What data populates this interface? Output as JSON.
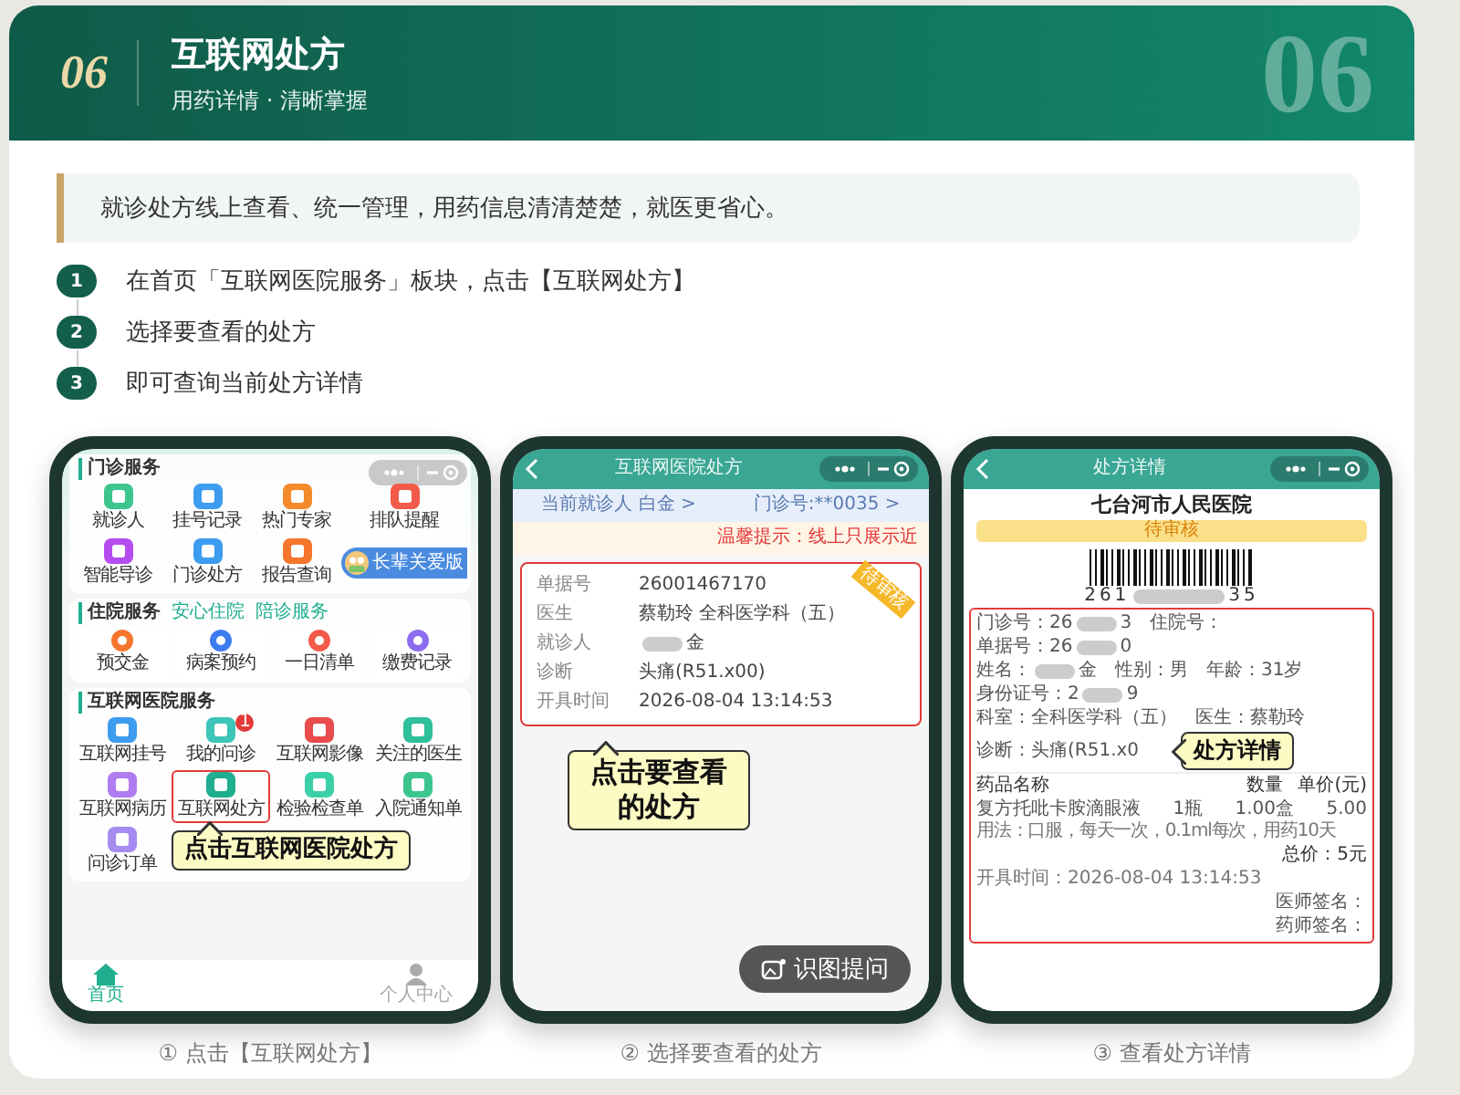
{
  "header": {
    "number": "06",
    "title": "互联网处方",
    "subtitle": "用药详情 · 清晰掌握",
    "watermark": "06"
  },
  "intro": "就诊处方线上查看、统一管理，用药信息清清楚楚，就医更省心。",
  "steps": [
    {
      "number": "1",
      "text": "在首页「互联网医院服务」板块，点击【互联网处方】"
    },
    {
      "number": "2",
      "text": "选择要查看的处方"
    },
    {
      "number": "3",
      "text": "即可查询当前处方详情"
    }
  ],
  "phones": [
    {
      "kind": "home",
      "sections": [
        {
          "title": "门诊服务",
          "kind": "grid",
          "banner": "长辈关爱版",
          "items": [
            {
              "label": "就诊人",
              "color": "#3cc58f",
              "highlighted": false
            },
            {
              "label": "挂号记录",
              "color": "#3d9cf0",
              "highlighted": false
            },
            {
              "label": "热门专家",
              "color": "#f58a2c",
              "highlighted": false
            },
            {
              "label": "排队提醒",
              "color": "#f25a4a",
              "highlighted": false
            },
            {
              "label": "智能导诊",
              "color": "#b54cf0",
              "highlighted": false
            },
            {
              "label": "门诊处方",
              "color": "#3d9cf0",
              "highlighted": false
            },
            {
              "label": "报告查询",
              "color": "#f5762c",
              "highlighted": false
            }
          ]
        },
        {
          "title": "住院服务",
          "kind": "tiles",
          "tags": [
            "安心住院",
            "陪诊服务"
          ],
          "items": [
            {
              "label": "预交金",
              "color": "#f5762c",
              "highlighted": false
            },
            {
              "label": "病案预约",
              "color": "#3d7cf0",
              "highlighted": false
            },
            {
              "label": "一日清单",
              "color": "#f25a4a",
              "highlighted": false
            },
            {
              "label": "缴费记录",
              "color": "#8b6cf0",
              "highlighted": false
            }
          ]
        },
        {
          "title": "互联网医院服务",
          "kind": "grid",
          "items": [
            {
              "label": "互联网挂号",
              "color": "#3d9cf0",
              "highlighted": false
            },
            {
              "label": "我的问诊",
              "color": "#3cc5b8",
              "highlighted": false,
              "badge": "1"
            },
            {
              "label": "互联网影像",
              "color": "#e84b4b",
              "highlighted": false
            },
            {
              "label": "关注的医生",
              "color": "#2fbf9a",
              "highlighted": false
            },
            {
              "label": "互联网病历",
              "color": "#b07cf0",
              "highlighted": false
            },
            {
              "label": "互联网处方",
              "color": "#1fae8f",
              "highlighted": true
            },
            {
              "label": "检验检查单",
              "color": "#3cd0a8",
              "highlighted": false
            },
            {
              "label": "入院通知单",
              "color": "#3cc58f",
              "highlighted": false
            },
            {
              "label": "问诊订单",
              "color": "#a68cf0",
              "highlighted": false
            }
          ]
        }
      ],
      "tabs": [
        {
          "label": "首页",
          "selected": true
        },
        {
          "label": "个人中心",
          "selected": false
        }
      ],
      "callout": "点击互联网医院处方"
    },
    {
      "kind": "list",
      "title": "互联网医院处方",
      "patient": "当前就诊人 白金 >",
      "clinic_no": "门诊号:**0035 >",
      "notice": "温馨提示：线上只展示近",
      "records": [
        {
          "status": "待审核",
          "highlighted": true,
          "fields": [
            {
              "label": "单据号",
              "value": "26001467170",
              "masked": false
            },
            {
              "label": "医生",
              "value": "蔡勒玲 全科医学科（五）",
              "masked": false
            },
            {
              "label": "就诊人",
              "suffix": "金",
              "masked": true
            },
            {
              "label": "诊断",
              "value": "头痛(R51.x00)",
              "masked": false
            },
            {
              "label": "开具时间",
              "value": "2026-08-04 13:14:53",
              "masked": false
            }
          ]
        }
      ],
      "callout": "点击要查看的处方",
      "float_button": "识图提问"
    },
    {
      "kind": "detail",
      "title": "处方详情",
      "hospital": "七台河市人民医院",
      "status": "待审核",
      "barcode_number": {
        "value": "261",
        "suffix": "35",
        "masked": true
      },
      "highlighted": true,
      "info_rows": [
        [
          {
            "label": "门诊号：",
            "value": "26",
            "suffix": "3",
            "masked": true
          },
          {
            "label": "住院号：",
            "masked": false
          }
        ],
        [
          {
            "label": "单据号：",
            "value": "26",
            "suffix": "0",
            "masked": true
          }
        ],
        [
          {
            "label": "姓名：",
            "suffix": "金",
            "masked": true
          },
          {
            "label": "性别：",
            "value": "男",
            "masked": false
          },
          {
            "label": "年龄：",
            "value": "31岁",
            "masked": false
          }
        ],
        [
          {
            "label": "身份证号：",
            "value": "2",
            "suffix": "9",
            "masked": true
          }
        ],
        [
          {
            "label": "科室：",
            "value": "全科医学科（五）",
            "masked": false
          },
          {
            "label": "医生：",
            "value": "蔡勒玲",
            "masked": false
          }
        ],
        [
          {
            "label": "诊断：",
            "value": "头痛(R51.x0",
            "masked": false
          }
        ]
      ],
      "table_header": [
        "药品名称",
        "数量",
        "单价(元)"
      ],
      "drugs": [
        {
          "name": "复方托吡卡胺滴眼液",
          "spec": "1瓶",
          "quantity": "1.00盒",
          "price": "5.00",
          "usage": "用法：口服，每天一次，0.1ml每次，用药10天"
        }
      ],
      "total": "总价：5元",
      "issued": "开具时间：2026-08-04 13:14:53",
      "signatures": [
        "医师签名：",
        "药师签名："
      ],
      "callout": "处方详情"
    }
  ],
  "captions": [
    "① 点击【互联网处方】",
    "② 选择要查看的处方",
    "③ 查看处方详情"
  ]
}
